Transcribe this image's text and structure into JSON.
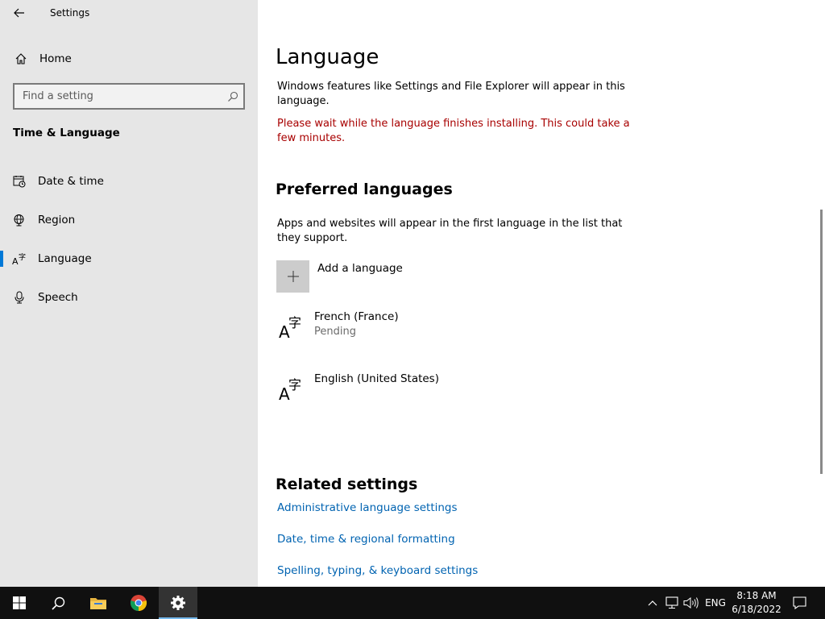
{
  "window": {
    "app_title": "Settings"
  },
  "sidebar": {
    "home_label": "Home",
    "search_placeholder": "Find a setting",
    "section_title": "Time & Language",
    "items": [
      {
        "label": "Date & time",
        "icon": "date-time-icon",
        "active": false
      },
      {
        "label": "Region",
        "icon": "globe-icon",
        "active": false
      },
      {
        "label": "Language",
        "icon": "language-icon",
        "active": true
      },
      {
        "label": "Speech",
        "icon": "microphone-icon",
        "active": false
      }
    ]
  },
  "main": {
    "title": "Language",
    "description": "Windows features like Settings and File Explorer will appear in this language.",
    "warning": "Please wait while the language finishes installing. This could take a few minutes.",
    "preferred_heading": "Preferred languages",
    "preferred_description": "Apps and websites will appear in the first language in the list that they support.",
    "add_language_label": "Add a language",
    "languages": [
      {
        "name": "French (France)",
        "status": "Pending"
      },
      {
        "name": "English (United States)",
        "status": ""
      }
    ],
    "related_heading": "Related settings",
    "related_links": [
      "Administrative language settings",
      "Date, time & regional formatting",
      "Spelling, typing, & keyboard settings"
    ]
  },
  "taskbar": {
    "language_indicator": "ENG",
    "time": "8:18 AM",
    "date": "6/18/2022"
  },
  "colors": {
    "accent": "#0078d7",
    "warning": "#a80000",
    "link": "#0063b1",
    "sidebar_bg": "#e6e6e6",
    "taskbar_bg": "#101010"
  }
}
